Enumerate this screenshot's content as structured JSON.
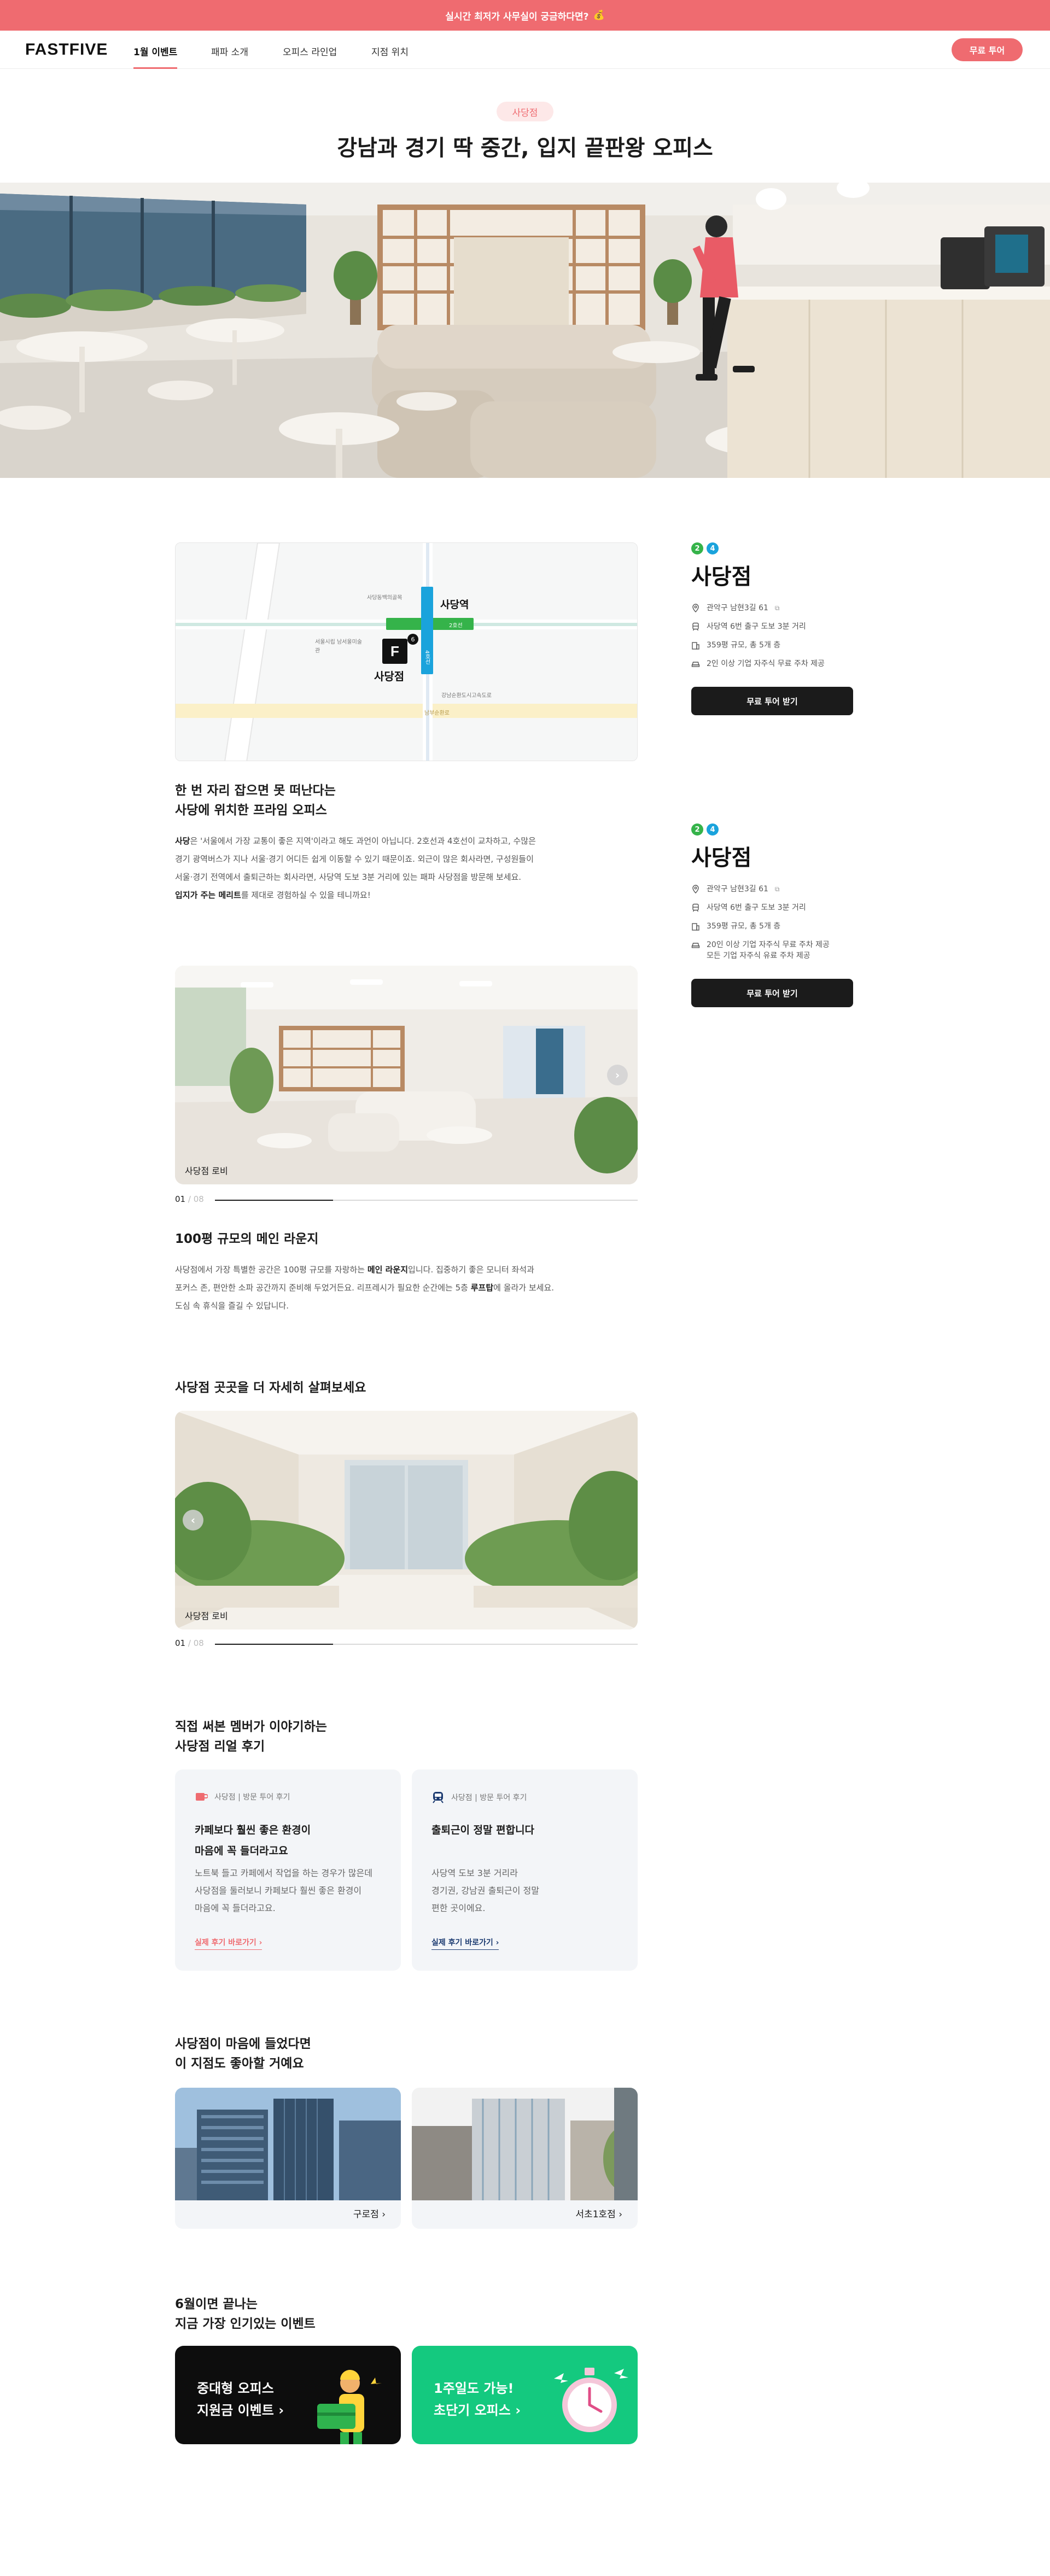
{
  "banner": {
    "text": "실시간 최저가 사무실이 궁금하다면?",
    "emoji": "💰"
  },
  "nav": {
    "logo": "FASTFIVE",
    "items": [
      "1월 이벤트",
      "패파 소개",
      "오피스 라인업",
      "지점 위치"
    ],
    "cta": "무료 투어"
  },
  "hero": {
    "chip": "사당점",
    "title": "강남과 경기 딱 중간, 입지 끝판왕 오피스"
  },
  "map": {
    "station": "사당역",
    "branch_mark": "F",
    "branch": "사당점",
    "labels": [
      "사당동백의골목",
      "서울시립 남서울미술관",
      "강남순환도시고속도로"
    ],
    "line2": "2호선",
    "line4": "4호선",
    "road": "남부순환로",
    "exit": "6"
  },
  "intro": {
    "title_line1": "한 번 자리 잡으면 못 떠난다는",
    "title_line2": "사당에 위치한 프라임 오피스",
    "p1_bold": "사당",
    "p1": "은 '서울에서 가장 교통이 좋은 지역'이라고 해도 과언이 아닙니다. 2호선과 4호선이 교차하고, 수많은",
    "p2": "경기 광역버스가 지나 서울·경기 어디든 쉽게 이동할 수 있기 때문이죠. 외근이 많은 회사라면, 구성원들이",
    "p3": "서울·경기 전역에서 출퇴근하는 회사라면, 사당역 도보 3분 거리에 있는 패파 사당점을 방문해 보세요.",
    "p4_bold": "입지가 주는 메리트",
    "p4": "를 제대로 경험하실 수 있을 테니까요!"
  },
  "side": {
    "card1": {
      "lines": [
        "2",
        "4"
      ],
      "name": "사당점",
      "rows": [
        "관악구 남현3길 61",
        "사당역 6번 출구 도보 3분 거리",
        "359평 규모, 총 5개 층",
        "2인 이상 기업 자주식 무료 주차 제공"
      ],
      "button": "무료 투어 받기"
    },
    "card2": {
      "lines": [
        "2",
        "4"
      ],
      "name": "사당점",
      "rows": [
        "관악구 남현3길 61",
        "사당역 6번 출구 도보 3분 거리",
        "359평 규모, 총 5개 층",
        "20인 이상 기업 자주식 무료 주차 제공",
        "모든 기업 자주식 유료 주차 제공"
      ],
      "button": "무료 투어 받기"
    }
  },
  "gallery1": {
    "caption": "사당점 로비",
    "page_current": "01",
    "page_total": "08",
    "progress": 0.28,
    "title": "100평 규모의 메인 라운지",
    "p1a": "사당점에서 가장 특별한 공간은 100평 규모를 자랑하는 ",
    "p1b": "메인 라운지",
    "p1c": "입니다.  집중하기 좋은 모니터 좌석과",
    "p2a": "포커스 존, 편안한 소파 공간까지 준비해 두었거든요. 리프레시가 필요한 순간에는 5층 ",
    "p2b": "루프탑",
    "p2c": "에 올라가 보세요.",
    "p3": "도심 속 휴식을 즐길 수 있답니다."
  },
  "gallery2": {
    "title": "사당점 곳곳을 더 자세히 살펴보세요",
    "caption": "사당점 로비",
    "page_current": "01",
    "page_total": "08",
    "progress": 0.28
  },
  "reviews": {
    "title_line1": "직접 써본 멤버가 이야기하는",
    "title_line2": "사당점 리얼 후기",
    "items": [
      {
        "meta": "사당점 | 방문 투어 후기",
        "title1": "카페보다 훨씬 좋은 환경이",
        "title2": "마음에 꼭 들더라고요",
        "text1": "노트북 들고 카페에서 작업을 하는 경우가 많은데",
        "text2": "사당점을 둘러보니 카페보다 훨씬 좋은 환경이",
        "text3": "마음에 꼭 들더라고요.",
        "link": "실제 후기 바로가기 ›",
        "color": "#ef6b70"
      },
      {
        "meta": "사당점 | 방문 투어 후기",
        "title1": "출퇴근이 정말 편합니다",
        "title2": "",
        "text1": "사당역 도보 3분 거리라",
        "text2": "경기권, 강남권 출퇴근이 정말",
        "text3": "편한 곳이에요.",
        "link": "실제 후기 바로가기 ›",
        "color": "#1b3a70"
      }
    ]
  },
  "recommend": {
    "title_line1": "사당점이 마음에 들었다면",
    "title_line2": "이 지점도 좋아할 거예요",
    "items": [
      {
        "label": "구로점 ›"
      },
      {
        "label": "서초1호점 ›"
      }
    ]
  },
  "events": {
    "title_line1": "6월이면 끝나는",
    "title_line2": "지금 가장 인기있는 이벤트",
    "items": [
      {
        "line1": "중대형 오피스",
        "line2": "지원금 이벤트  ›",
        "bg": "#0d0d0d"
      },
      {
        "line1": "1주일도 가능!",
        "line2": "초단기 오피스  ›",
        "bg": "#14c97f"
      }
    ]
  },
  "colors": {
    "accent": "#ef6b70",
    "line2": "#35b34a",
    "line4": "#1aa3dc",
    "dark": "#1b1b1b"
  }
}
